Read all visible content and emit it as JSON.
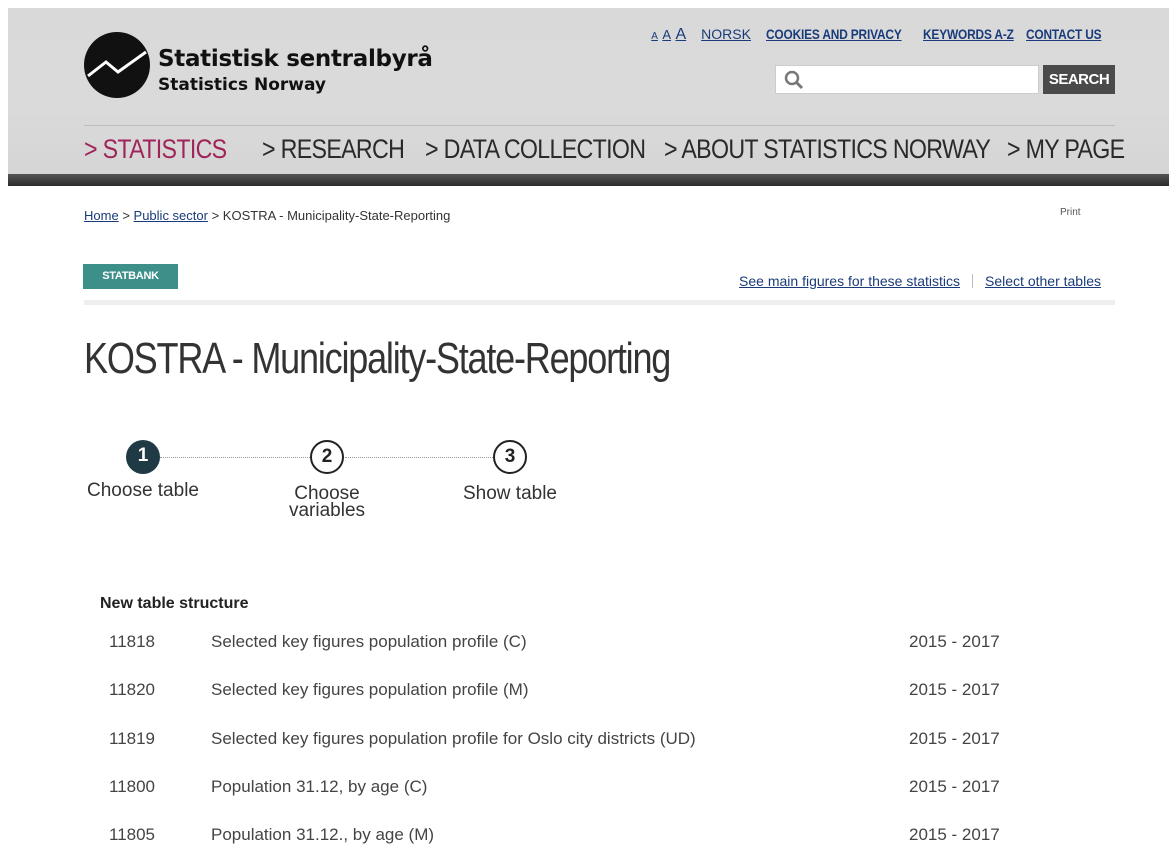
{
  "brand": {
    "name_no": "Statistisk sentralbyrå",
    "name_en": "Statistics Norway"
  },
  "toplinks": {
    "text_size": [
      "A",
      "A",
      "A"
    ],
    "norsk": "NORSK",
    "cookies": "COOKIES AND PRIVACY",
    "keywords": "KEYWORDS A-Z",
    "contact": "CONTACT US"
  },
  "search": {
    "placeholder": "",
    "button": "SEARCH"
  },
  "nav": [
    {
      "label": "> STATISTICS",
      "active": true
    },
    {
      "label": "> RESEARCH"
    },
    {
      "label": "> DATA COLLECTION"
    },
    {
      "label": "> ABOUT STATISTICS NORWAY"
    },
    {
      "label": "> MY PAGE"
    }
  ],
  "breadcrumb": {
    "home": "Home",
    "sep": ">",
    "public_sector": "Public sector",
    "current": "KOSTRA - Municipality-State-Reporting"
  },
  "print": "Print",
  "statbank": "STATBANK",
  "sublinks": {
    "main_figures": "See main figures for these statistics",
    "other_tables": "Select other tables"
  },
  "page_title": "KOSTRA - Municipality-State-Reporting",
  "steps": [
    {
      "num": "1",
      "label": "Choose table"
    },
    {
      "num": "2",
      "label": "Choose variables"
    },
    {
      "num": "3",
      "label": "Show table"
    }
  ],
  "section_title": "New table structure",
  "tables": [
    {
      "code": "11818",
      "name": "Selected key figures population profile (C)",
      "years": "2015 - 2017"
    },
    {
      "code": "11820",
      "name": "Selected key figures population profile (M)",
      "years": "2015 - 2017"
    },
    {
      "code": "11819",
      "name": "Selected key figures population profile for Oslo city districts (UD)",
      "years": "2015 - 2017"
    },
    {
      "code": "11800",
      "name": "Population 31.12, by age (C)",
      "years": "2015 - 2017"
    },
    {
      "code": "11805",
      "name": "Population 31.12., by age (M)",
      "years": "2015 - 2017"
    }
  ]
}
